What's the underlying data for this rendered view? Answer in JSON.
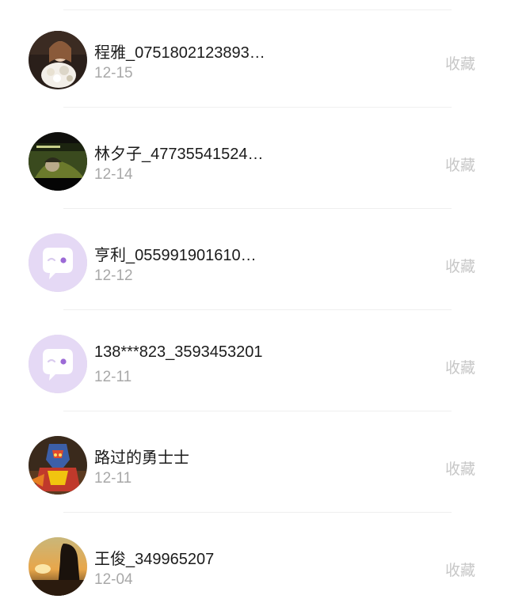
{
  "list": {
    "items": [
      {
        "name": "程雅_0751802123893…",
        "date": "12-15",
        "action": "收藏",
        "avatar": "photo-avatar-girl-with-flowers"
      },
      {
        "name": "林夕子_47735541524…",
        "date": "12-14",
        "action": "收藏",
        "avatar": "photo-avatar-anime-scene"
      },
      {
        "name": "亨利_055991901610…",
        "date": "12-12",
        "action": "收藏",
        "avatar": "default-chat-avatar-icon"
      },
      {
        "name": "138***823_3593453201",
        "date": "12-11",
        "action": "收藏",
        "avatar": "default-chat-avatar-icon"
      },
      {
        "name": "路过的勇士士",
        "date": "12-11",
        "action": "收藏",
        "avatar": "photo-avatar-armored-hero"
      },
      {
        "name": "王俊_349965207",
        "date": "12-04",
        "action": "收藏",
        "avatar": "photo-avatar-sunset-silhouette"
      }
    ]
  },
  "colors": {
    "name_text": "#1b1b1b",
    "date_text": "#a8a8a8",
    "action_text": "#c7c7c7",
    "default_avatar_bg": "#e5d9f5",
    "default_avatar_accent": "#9c6ad6"
  }
}
